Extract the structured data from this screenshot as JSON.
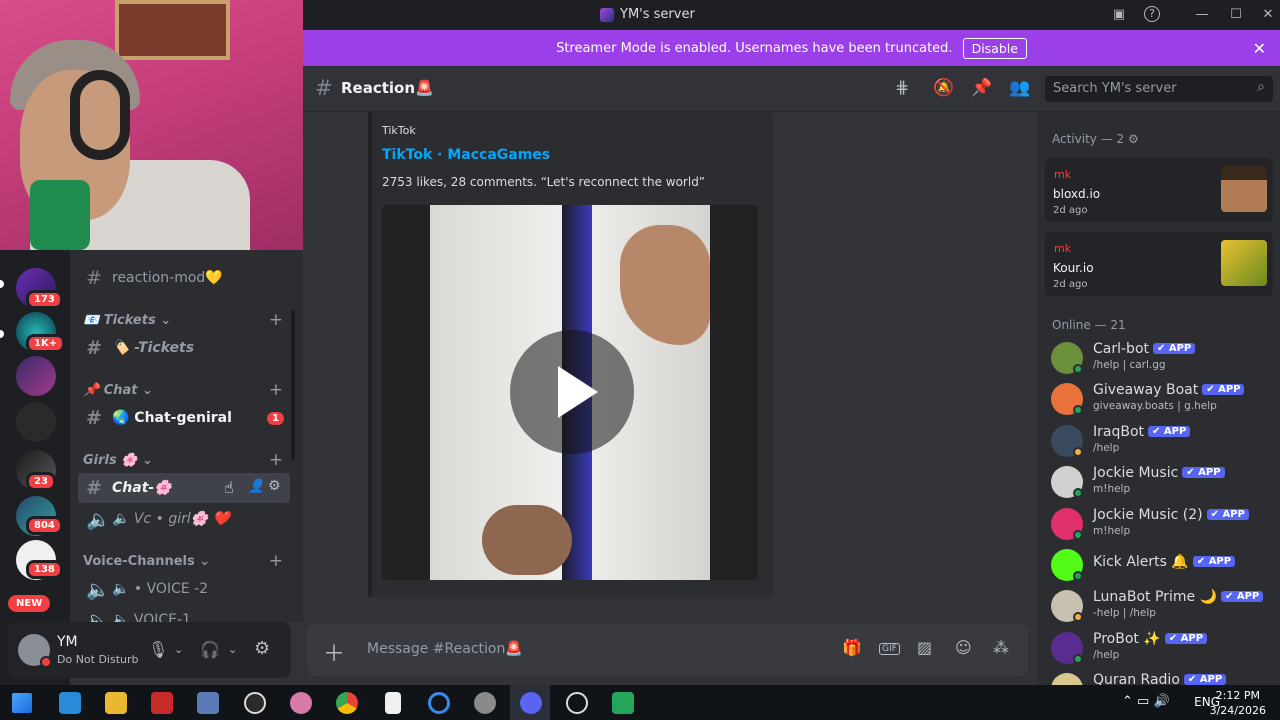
{
  "window": {
    "title": "YM's server"
  },
  "banner": {
    "text": "Streamer Mode is enabled. Usernames have been truncated.",
    "button": "Disable"
  },
  "servers": {
    "badges": [
      "173",
      "1K+",
      "23",
      "804",
      "138"
    ],
    "new_label": "NEW"
  },
  "channels": {
    "reaction_mod": "reaction-mod💛",
    "cat_tickets": "📧 Tickets ⌄",
    "tickets": "🏷️ -Tickets",
    "cat_chat": "📌 Chat ⌄",
    "chat_geniral": "🌏 Chat-geniral",
    "chat_geniral_mention": "1",
    "cat_girls": "Girls 🌸 ⌄",
    "chat_girls": "Chat-🌸",
    "vc_girl": "🔈 Vc • girl🌸 ❤️",
    "cat_voice": "Voice-Channels ⌄",
    "voice2": "🔈 • VOICE -2",
    "voice1": "🔈 VOICE-1"
  },
  "user": {
    "name": "YM",
    "status": "Do Not Disturb"
  },
  "chat": {
    "channel": "Reaction🚨",
    "search_placeholder": "Search YM's server",
    "composer_placeholder": "Message #Reaction🚨"
  },
  "embed": {
    "provider": "TikTok",
    "title": "TikTok · MaccaGames",
    "description": "2753 likes, 28 comments. “Let's reconnect the world”"
  },
  "members": {
    "activity_header": "Activity — 2 ⚙",
    "activities": [
      {
        "user": "mk",
        "game": "bloxd.io",
        "when": "2d ago",
        "art_color": "#6b4a2e"
      },
      {
        "user": "mk",
        "game": "Kour.io",
        "when": "2d ago",
        "art_color": "#c9a320"
      }
    ],
    "online_header": "Online — 21",
    "app_badge": "✔ APP",
    "list": [
      {
        "name": "Carl-bot",
        "status": "/help | carl.gg",
        "color": "#6b8f3a"
      },
      {
        "name": "Giveaway Boat",
        "status": "giveaway.boats | g.help",
        "color": "#e8733a"
      },
      {
        "name": "IraqBot",
        "status": "/help",
        "color": "#3a4a5e"
      },
      {
        "name": "Jockie Music",
        "status": "m!help",
        "color": "#d0d0d0"
      },
      {
        "name": "Jockie Music (2)",
        "status": "m!help",
        "color": "#e02f6a"
      },
      {
        "name": "Kick Alerts 🔔",
        "status": "",
        "color": "#53fc18"
      },
      {
        "name": "LunaBot Prime 🌙",
        "status": "-help | /help",
        "color": "#c8c0b0"
      },
      {
        "name": "ProBot ✨",
        "status": "/help",
        "color": "#5b2c8f"
      },
      {
        "name": "Quran Radio",
        "status": "",
        "color": "#d8c890"
      }
    ]
  },
  "taskbar": {
    "lang": "ENG",
    "time": "2:12 PM",
    "date": "3/24/2026"
  },
  "colors": {
    "accent": "#5865f2",
    "banner": "#9b3fe8",
    "link": "#00a8fc",
    "danger": "#f23f43"
  }
}
